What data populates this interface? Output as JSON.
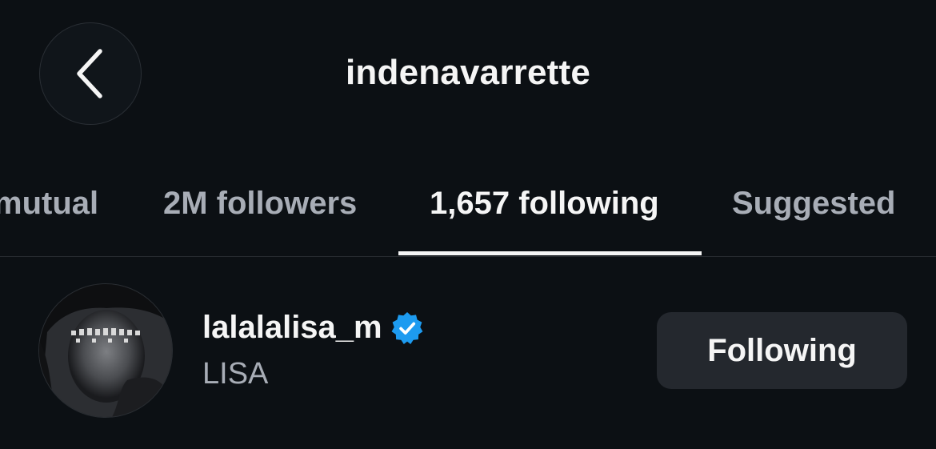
{
  "header": {
    "title": "indenavarrette",
    "back_icon": "chevron-left-icon"
  },
  "tabs": [
    {
      "label": "mutual",
      "active": false
    },
    {
      "label": "2M followers",
      "active": false
    },
    {
      "label": "1,657 following",
      "active": true
    },
    {
      "label": "Suggested",
      "active": false
    }
  ],
  "list": {
    "items": [
      {
        "username": "lalalalisa_m",
        "verified": true,
        "verified_color": "#1d9bf0",
        "full_name": "LISA",
        "button_label": "Following"
      }
    ]
  },
  "colors": {
    "background": "#0c1014",
    "text_primary": "#f5f5f5",
    "text_secondary": "#a8adb6",
    "button_bg": "#24282e"
  }
}
